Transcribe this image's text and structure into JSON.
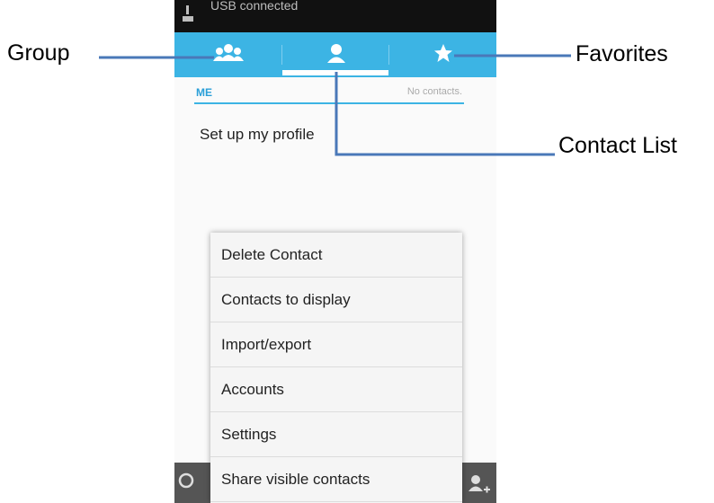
{
  "annotations": {
    "group": "Group",
    "favorites": "Favorites",
    "contact_list": "Contact List"
  },
  "status_bar": {
    "text": "USB connected"
  },
  "tabs": [
    {
      "name": "groups",
      "icon": "group-icon"
    },
    {
      "name": "contacts",
      "icon": "person-icon",
      "selected": true
    },
    {
      "name": "favorites",
      "icon": "star-icon"
    }
  ],
  "me_section": {
    "label": "ME",
    "count": "No contacts."
  },
  "profile": {
    "label": "Set up my profile"
  },
  "menu": {
    "items": [
      "Delete Contact",
      "Contacts to display",
      "Import/export",
      "Accounts",
      "Settings",
      "Share visible contacts"
    ]
  },
  "bottom_bar": {
    "icons": [
      "search-icon",
      "add-contact-icon"
    ]
  },
  "colors": {
    "accent": "#3cb4e4",
    "callout_line": "#4a78b8"
  }
}
